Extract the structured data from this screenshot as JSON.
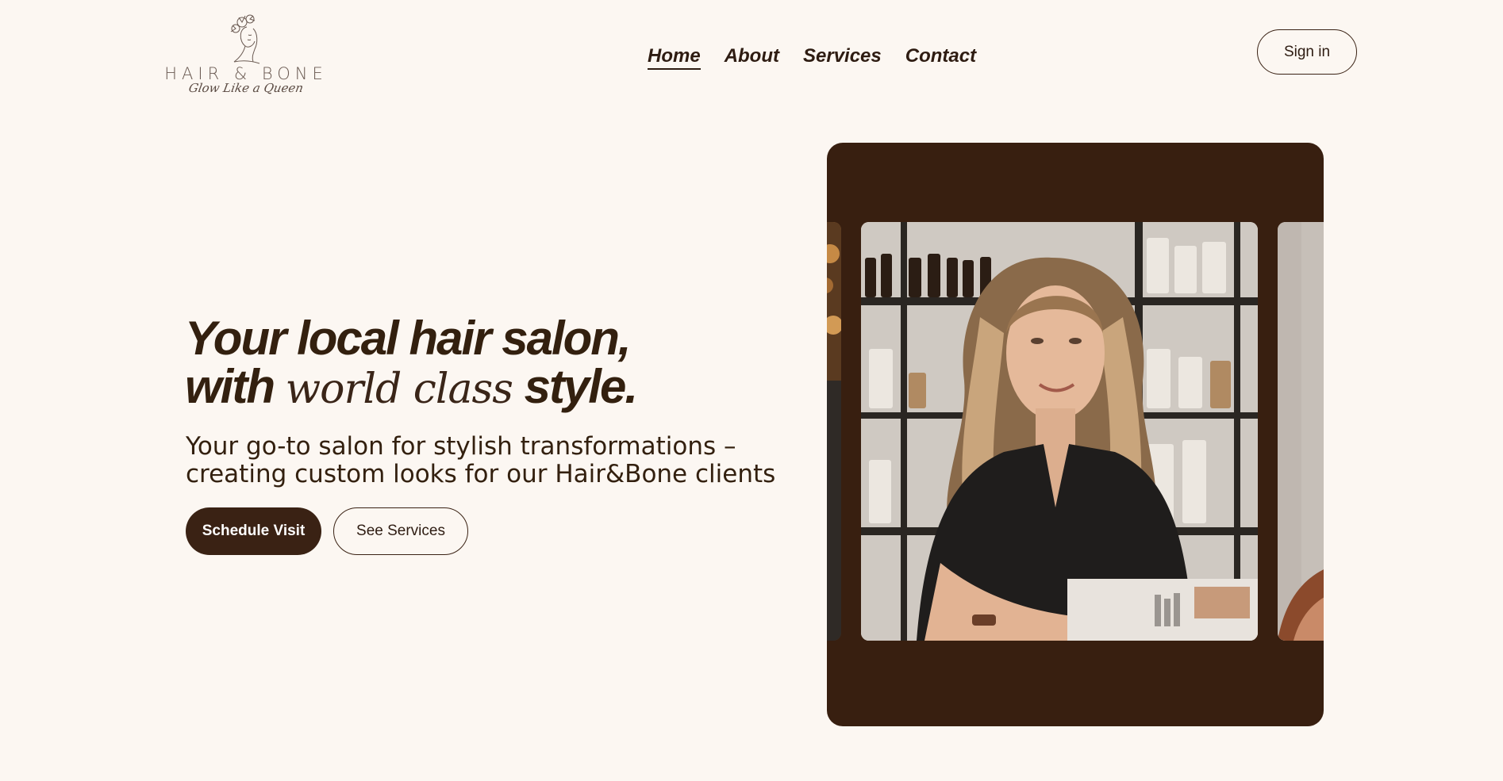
{
  "brand": {
    "name": "HAIR & BONE",
    "tagline": "Glow Like a Queen"
  },
  "nav": {
    "items": [
      {
        "label": "Home",
        "active": true
      },
      {
        "label": "About",
        "active": false
      },
      {
        "label": "Services",
        "active": false
      },
      {
        "label": "Contact",
        "active": false
      }
    ],
    "signin_label": "Sign in"
  },
  "hero": {
    "title_line1": "Your local hair salon,",
    "title_line2_bold_start": "with",
    "title_line2_serif": "world class",
    "title_line2_bold_end": "style.",
    "subtitle_line1": "Your go-to salon for stylish transformations –",
    "subtitle_line2": "creating custom looks for our Hair&Bone clients",
    "primary_cta": "Schedule Visit",
    "secondary_cta": "See Services"
  },
  "carousel": {
    "background_color": "#381f10",
    "slides": [
      {
        "name": "previous-slide"
      },
      {
        "name": "stylist-portrait"
      },
      {
        "name": "next-slide"
      }
    ]
  },
  "colors": {
    "page_background": "#fcf7f2",
    "accent_dark": "#3a2214",
    "text": "#33200f"
  }
}
